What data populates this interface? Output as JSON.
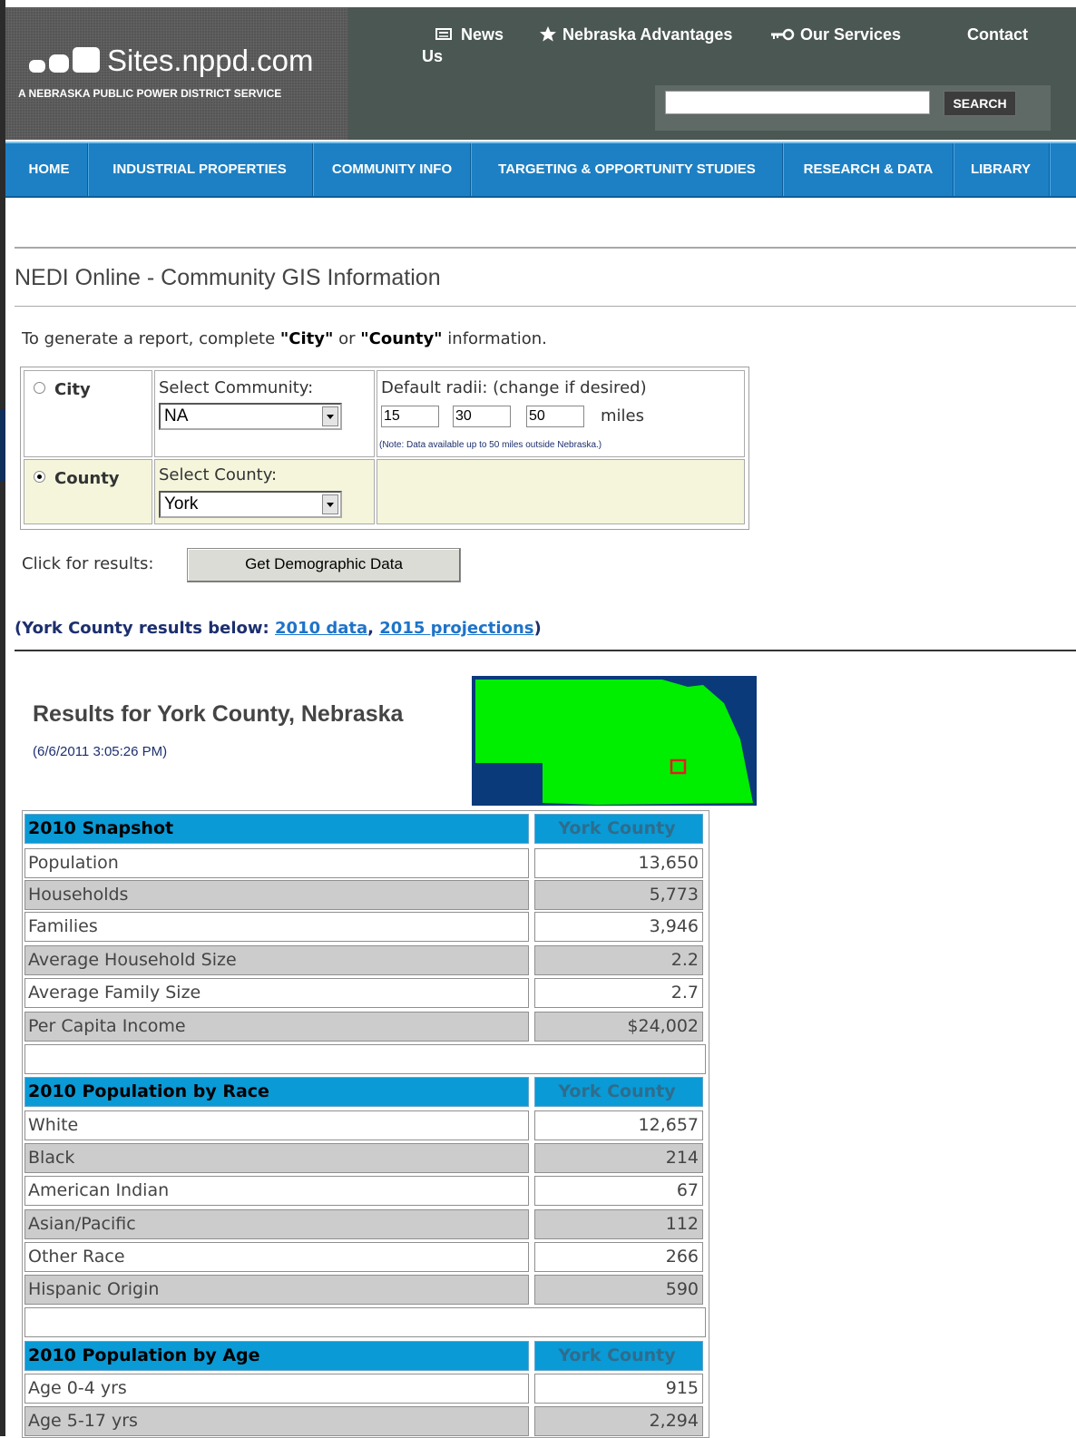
{
  "header": {
    "logo_text": "Sites.nppd.com",
    "tagline": "A NEBRASKA PUBLIC POWER DISTRICT SERVICE",
    "links": {
      "news": "News",
      "advantages": "Nebraska Advantages",
      "services": "Our Services",
      "contact": "Contact",
      "contact_us": "Us"
    },
    "search_value": "",
    "search_button": "SEARCH"
  },
  "nav": [
    "HOME",
    "INDUSTRIAL PROPERTIES",
    "COMMUNITY INFO",
    "TARGETING & OPPORTUNITY STUDIES",
    "RESEARCH & DATA",
    "LIBRARY"
  ],
  "page": {
    "title": "NEDI Online - Community GIS Information",
    "instr_pre": "To generate a report, complete ",
    "instr_city": "\"City\"",
    "instr_or": " or ",
    "instr_county": "\"County\"",
    "instr_post": " information."
  },
  "form": {
    "city_label": "City",
    "county_label": "County",
    "selected_option": "County",
    "select_community_label": "Select Community:",
    "community_value": "NA",
    "radii_label": "Default radii: (change if desired)",
    "radii": [
      "15",
      "30",
      "50"
    ],
    "radii_unit": "miles",
    "radii_note": "(Note: Data available up to 50 miles outside Nebraska.)",
    "select_county_label": "Select County:",
    "county_value": "York",
    "click_label": "Click for results:",
    "button_label": "Get Demographic Data"
  },
  "results_line": {
    "prefix": "(York County results below: ",
    "link_2010": "2010 data",
    "sep": ", ",
    "link_2015": "2015 projections",
    "suffix": ")"
  },
  "results": {
    "title": "Results for York County, Nebraska",
    "timestamp": "(6/6/2011 3:05:26 PM)"
  },
  "colors": {
    "map_land": "#00ee00",
    "map_water": "#0a3a7a",
    "map_marker": "#e02020",
    "header_bg": "#4b5752",
    "nav_bg": "#1d80c4"
  },
  "table": {
    "snapshot": {
      "header": "2010 Snapshot",
      "col": "York County",
      "rows": [
        {
          "label": "Population",
          "value": "13,650"
        },
        {
          "label": "Households",
          "value": "5,773"
        },
        {
          "label": "Families",
          "value": "3,946"
        },
        {
          "label": "Average Household Size",
          "value": "2.2"
        },
        {
          "label": "Average Family Size",
          "value": "2.7"
        },
        {
          "label": "Per Capita Income",
          "value": "$24,002"
        }
      ]
    },
    "race": {
      "header": "2010 Population by Race",
      "col": "York County",
      "rows": [
        {
          "label": "White",
          "value": "12,657"
        },
        {
          "label": "Black",
          "value": "214"
        },
        {
          "label": "American Indian",
          "value": "67"
        },
        {
          "label": "Asian/Pacific",
          "value": "112"
        },
        {
          "label": "Other Race",
          "value": "266"
        },
        {
          "label": "Hispanic Origin",
          "value": "590"
        }
      ]
    },
    "age": {
      "header": "2010 Population by Age",
      "col": "York County",
      "rows": [
        {
          "label": "Age 0-4 yrs",
          "value": "915"
        },
        {
          "label": "Age 5-17 yrs",
          "value": "2,294"
        }
      ]
    }
  }
}
